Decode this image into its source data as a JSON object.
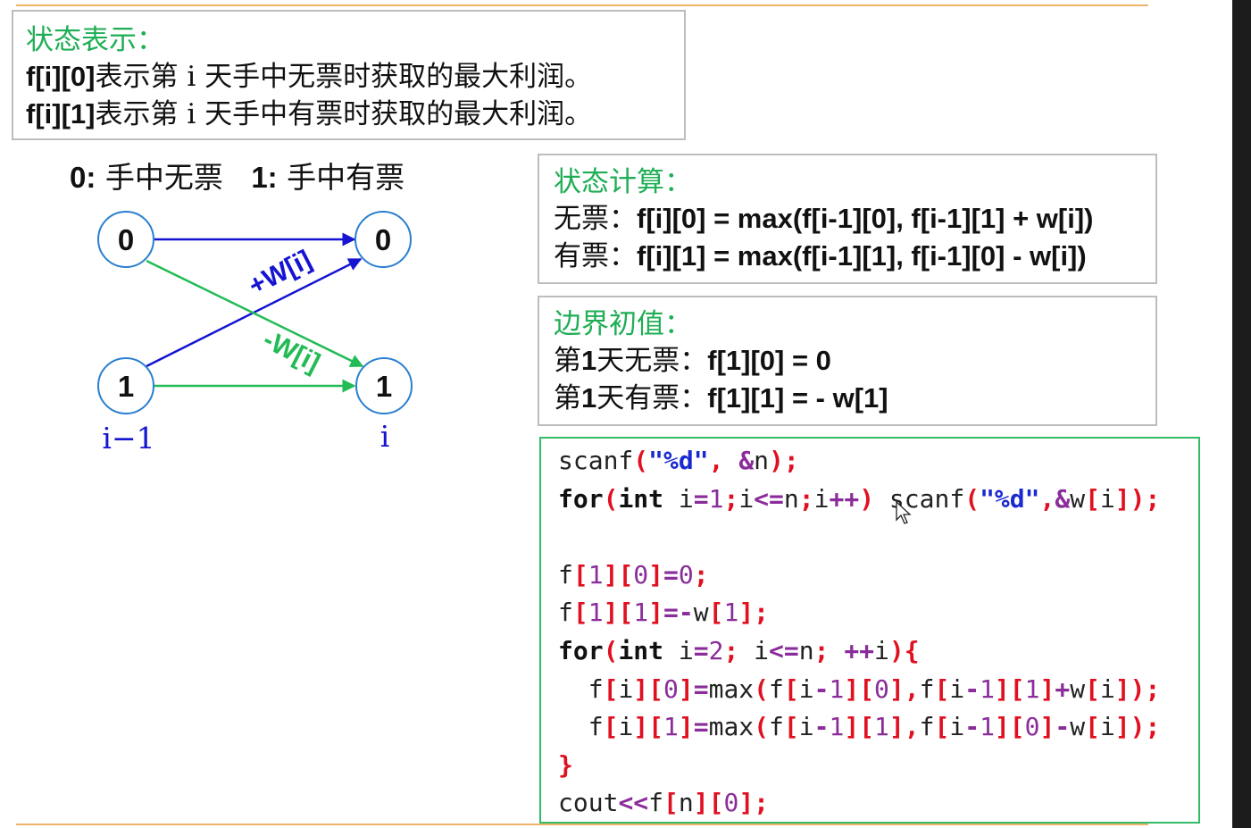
{
  "state_box": {
    "title": "状态表示：",
    "line1_code": "f[i][0]",
    "line1_text": "表示第 i 天手中无票时获取的最大利润。",
    "line2_code": "f[i][1]",
    "line2_text": "表示第 i 天手中有票时获取的最大利润。"
  },
  "legend": {
    "zero_key": "0:",
    "zero_text": "手中无票",
    "one_key": "1:",
    "one_text": "手中有票"
  },
  "diagram": {
    "left_top_node": "0",
    "left_bottom_node": "1",
    "right_top_node": "0",
    "right_bottom_node": "1",
    "plus_label": "+W[i]",
    "minus_label": "-W[i]",
    "left_col_label": "i−1",
    "right_col_label": "i",
    "colors": {
      "blue": "#1414d2",
      "green": "#22bb55",
      "node_border": "#2a7fd0",
      "col_label": "#1414d2"
    }
  },
  "calc_box": {
    "title": "状态计算：",
    "line1_label": "无票：",
    "line1_formula": "f[i][0] = max(f[i-1][0], f[i-1][1] + w[i])",
    "line2_label": "有票：",
    "line2_formula": "f[i][1] = max(f[i-1][1], f[i-1][0] - w[i])"
  },
  "init_box": {
    "title": "边界初值：",
    "line1_label_pre": "第",
    "line1_num": "1",
    "line1_label_post": "天无票：",
    "line1_formula": "f[1][0] = 0",
    "line2_label_pre": "第",
    "line2_num": "1",
    "line2_label_post": "天有票：",
    "line2_formula": "f[1][1] = - w[1]"
  },
  "code": {
    "l1": {
      "a": "scanf",
      "b": "(",
      "c": "\"%d\"",
      "d": ", ",
      "e": "&",
      "f": "n",
      "g": ");"
    },
    "l2": {
      "a": "for",
      "b": "(",
      "c": "int",
      "d": " i",
      "e": "=",
      "f": "1",
      "g": ";",
      "h": "i",
      "i": "<=",
      "j": "n",
      "k": ";",
      "l": "i",
      "m": "++",
      "n": ")",
      "o": " scanf",
      "p": "(",
      "q": "\"%d\"",
      "r": ",",
      "s": "&",
      "t": "w",
      "u": "[",
      "v": "i",
      "w": "]",
      "x": ");"
    },
    "l4": "f[1][0]=0;",
    "l5": "f[1][1]=-w[1];",
    "l6": "for(int i=2; i<=n; ++i){",
    "l7": "  f[i][0]=max(f[i-1][0],f[i-1][1]+w[i]);",
    "l8": "  f[i][1]=max(f[i-1][1],f[i-1][0]-w[i]);",
    "l9": "}",
    "l10": "cout<<f[n][0];"
  }
}
